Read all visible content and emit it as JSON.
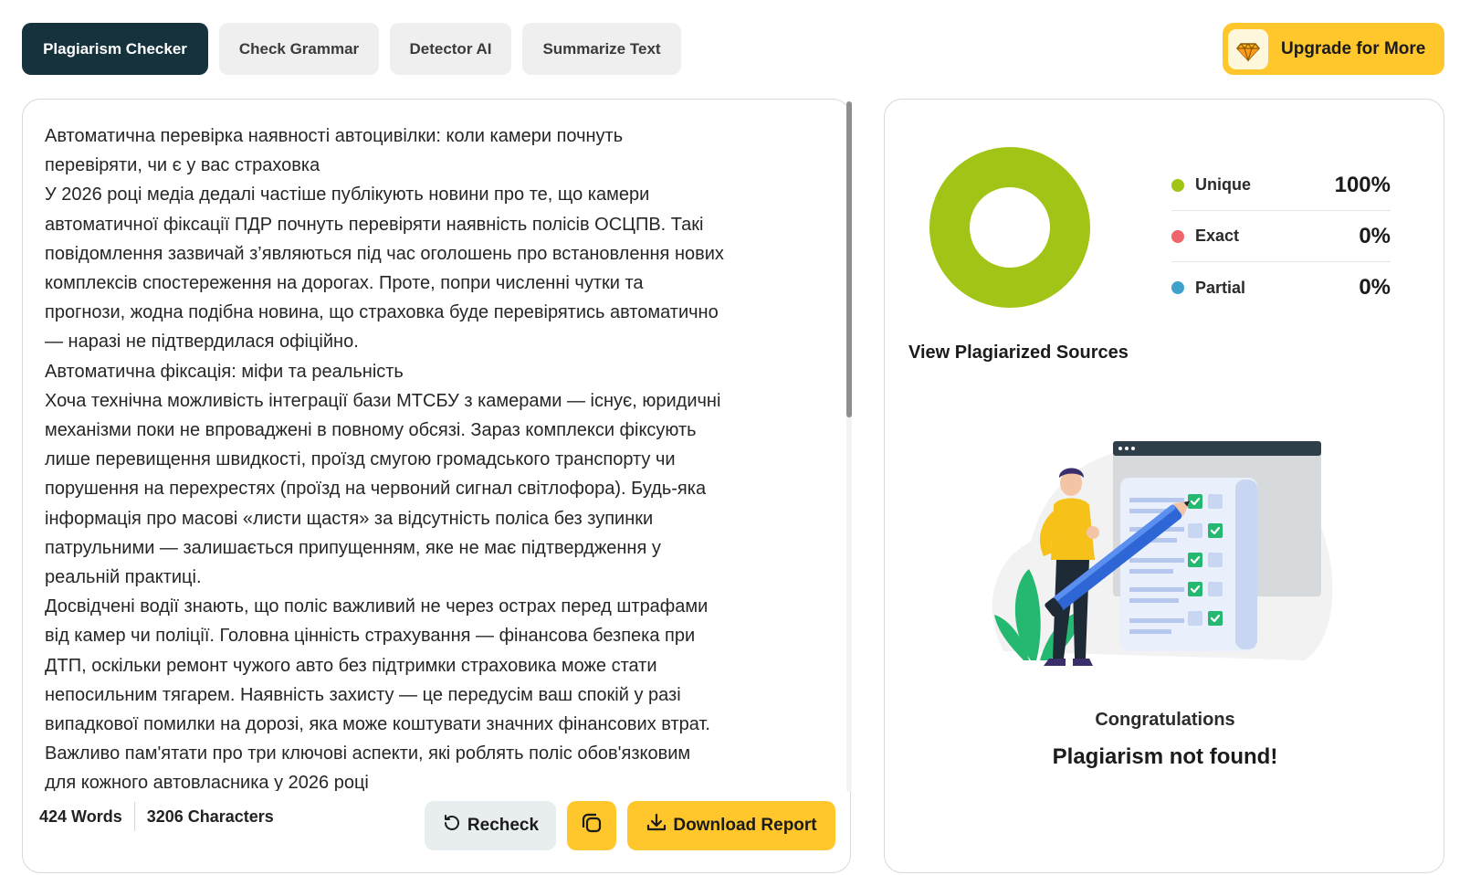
{
  "tabs": [
    {
      "label": "Plagiarism Checker",
      "active": true
    },
    {
      "label": "Check Grammar",
      "active": false
    },
    {
      "label": "Detector AI",
      "active": false
    },
    {
      "label": "Summarize Text",
      "active": false
    }
  ],
  "upgrade": {
    "label": "Upgrade for More",
    "icon": "diamond-icon"
  },
  "editor": {
    "text": "Автоматична перевірка наявності автоцивілки: коли камери почнуть\nперевіряти, чи є у вас страховка\nУ 2026 році медіа дедалі частіше публікують новини про те, що камери\nавтоматичної фіксації ПДР почнуть перевіряти наявність полісів ОСЦПВ. Такі\nповідомлення зазвичай з’являються під час оголошень про встановлення нових\nкомплексів спостереження на дорогах. Проте, попри численні чутки та\nпрогнози, жодна подібна новина, що страховка буде перевірятись автоматично\n— наразі не підтвердилася офіційно.\nАвтоматична фіксація: міфи та реальність\nХоча технічна можливість інтеграції бази МТСБУ з камерами — існує, юридичні\nмеханізми поки не впроваджені в повному обсязі. Зараз комплекси фіксують\nлише перевищення швидкості, проїзд смугою громадського транспорту чи\nпорушення на перехрестях (проїзд на червоний сигнал світлофора). Будь-яка\nінформація про масові «листи щастя» за відсутність поліса без зупинки\nпатрульними — залишається припущенням, яке не має підтвердження у\nреальній практиці.\nДосвідчені водії знають, що поліс важливий не через острах перед штрафами\nвід камер чи поліції. Головна цінність страхування — фінансова безпека при\nДТП, оскільки ремонт чужого авто без підтримки страховика може стати\nнепосильним тягарем. Наявність захисту — це передусім ваш спокій у разі\nвипадкової помилки на дорозі, яка може коштувати значних фінансових втрат.\nВажливо пам'ятати про три ключові аспекти, які роблять поліс обов'язковим\nдля кожного автовласника у 2026 році"
  },
  "counts": {
    "words": "424 Words",
    "characters": "3206 Characters"
  },
  "actions": {
    "recheck": "Recheck",
    "copy_icon": "copy-icon",
    "download": "Download Report"
  },
  "results": {
    "legend": [
      {
        "label": "Unique",
        "value": "100%",
        "percent": 100,
        "color": "#a1c416"
      },
      {
        "label": "Exact",
        "value": "0%",
        "percent": 0,
        "color": "#f0646c"
      },
      {
        "label": "Partial",
        "value": "0%",
        "percent": 0,
        "color": "#3fa2cc"
      }
    ],
    "sources_label": "View Plagiarized Sources",
    "congrats": "Congratulations",
    "status": "Plagiarism not found!"
  }
}
